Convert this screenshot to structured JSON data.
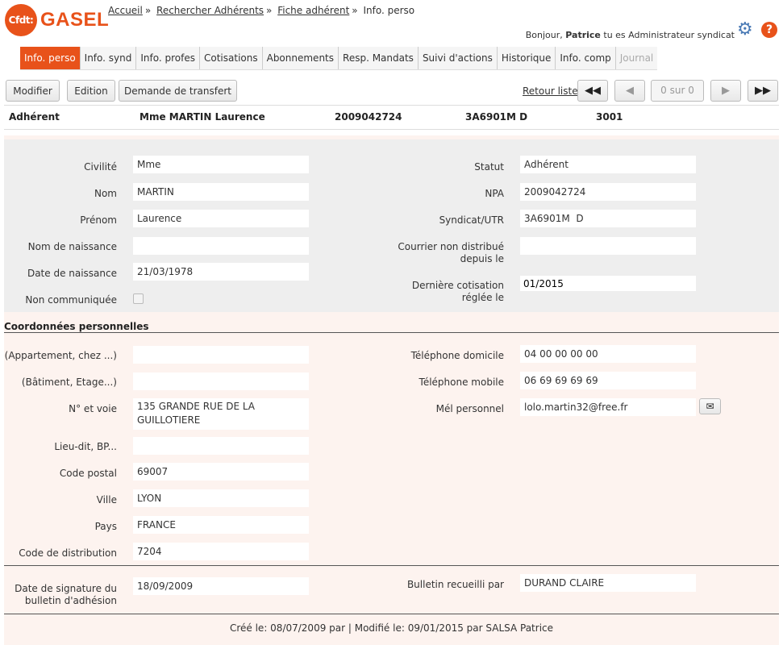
{
  "logo": {
    "badge": "Cfdt:",
    "name": "GASEL"
  },
  "breadcrumb": {
    "items": [
      "Accueil",
      "Rechercher Adhérents",
      "Fiche adhérent"
    ],
    "current": "Info. perso",
    "sep": "»"
  },
  "greeting": {
    "prefix": "Bonjour,",
    "user": "Patrice",
    "suffix": "tu es Administrateur syndicat"
  },
  "icons": {
    "settings": "gear-icon",
    "help": "help-icon"
  },
  "tabs": [
    {
      "label": "Info. perso",
      "active": true
    },
    {
      "label": "Info. synd"
    },
    {
      "label": "Info. profes"
    },
    {
      "label": "Cotisations"
    },
    {
      "label": "Abonnements"
    },
    {
      "label": "Resp. Mandats"
    },
    {
      "label": "Suivi d'actions"
    },
    {
      "label": "Historique"
    },
    {
      "label": "Info. comp"
    },
    {
      "label": "Journal",
      "disabled": true
    }
  ],
  "actions": {
    "modify": "Modifier",
    "edition": "Edition",
    "transfer": "Demande de transfert",
    "back": "Retour liste",
    "pager": "0 sur 0"
  },
  "summary": {
    "type": "Adhérent",
    "name": "Mme MARTIN Laurence",
    "npa": "2009042724",
    "syndicat": "3A6901M D",
    "code": "3001"
  },
  "identity": {
    "civilite": {
      "label": "Civilité",
      "value": "Mme"
    },
    "nom": {
      "label": "Nom",
      "value": "MARTIN"
    },
    "prenom": {
      "label": "Prénom",
      "value": "Laurence"
    },
    "nom_naissance": {
      "label": "Nom de naissance",
      "value": ""
    },
    "date_naissance": {
      "label": "Date de naissance",
      "value": "21/03/1978"
    },
    "non_communiquee": {
      "label": "Non communiquée",
      "checked": false
    },
    "statut": {
      "label": "Statut",
      "value": "Adhérent"
    },
    "npa": {
      "label": "NPA",
      "value": "2009042724"
    },
    "syndicat": {
      "label": "Syndicat/UTR",
      "value": "3A6901M  D"
    },
    "courrier_line1": "Courrier non distribué",
    "courrier_line2": "depuis le",
    "courrier_value": "",
    "derniere_line1": "Dernière cotisation",
    "derniere_line2": "réglée le",
    "derniere_value": "01/2015"
  },
  "coords": {
    "title": "Coordonnées personnelles",
    "appartement": {
      "label": "(Appartement, chez ...)",
      "value": ""
    },
    "batiment": {
      "label": "(Bâtiment, Etage...)",
      "value": ""
    },
    "voie": {
      "label": "N° et voie",
      "line1": "135 GRANDE RUE DE LA",
      "line2": "GUILLOTIERE"
    },
    "lieudit": {
      "label": "Lieu-dit, BP...",
      "value": ""
    },
    "code_postal": {
      "label": "Code postal",
      "value": "69007"
    },
    "ville": {
      "label": "Ville",
      "value": "LYON"
    },
    "pays": {
      "label": "Pays",
      "value": "FRANCE"
    },
    "code_distribution": {
      "label": "Code de distribution",
      "value": "7204"
    },
    "tel_domicile": {
      "label": "Téléphone domicile",
      "value": "04 00 00 00 00"
    },
    "tel_mobile": {
      "label": "Téléphone mobile",
      "value": "06 69 69 69 69"
    },
    "mel": {
      "label": "Mél personnel",
      "value": "lolo.martin32@free.fr"
    }
  },
  "bulletin": {
    "date_line1": "Date de signature du",
    "date_line2": "bulletin d'adhésion",
    "date_value": "18/09/2009",
    "recueilli_label": "Bulletin recueilli par",
    "recueilli_value": "DURAND CLAIRE"
  },
  "footer": "Créé le: 08/07/2009 par | Modifié le: 09/01/2015 par SALSA Patrice",
  "colors": {
    "brand": "#e8521a",
    "panel": "#eeeeee",
    "panel_alt": "#fdf3ef"
  }
}
